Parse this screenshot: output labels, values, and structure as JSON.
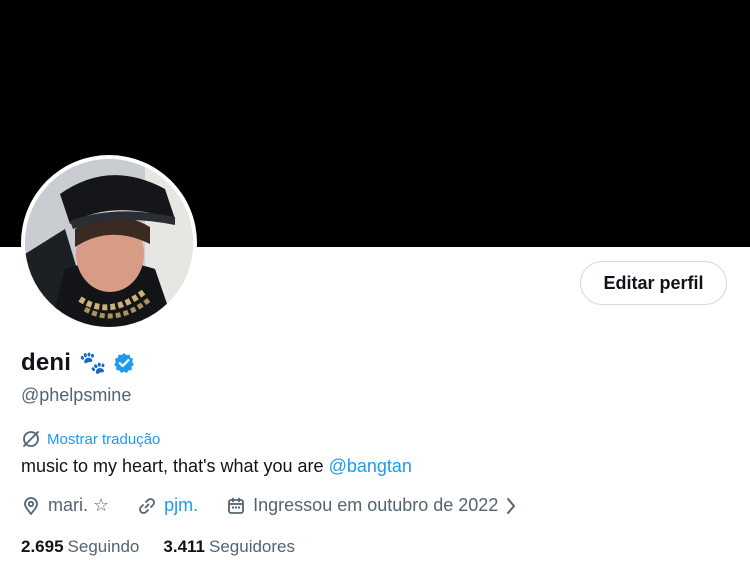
{
  "profile": {
    "display_name": "deni",
    "name_emoji": "🐾",
    "handle": "@phelpsmine",
    "translate_label": "Mostrar tradução",
    "bio_text": "music to my heart, that's what you are ",
    "bio_mention": "@bangtan",
    "location": "mari. ☆",
    "website": "pjm.",
    "joined": "Ingressou em outubro de 2022",
    "following_count": "2.695",
    "following_label": "Seguindo",
    "followers_count": "3.411",
    "followers_label": "Seguidores"
  },
  "actions": {
    "edit_profile_label": "Editar perfil"
  },
  "colors": {
    "banner": "#000000",
    "accent": "#1d9bf0",
    "secondary_text": "#536471"
  }
}
